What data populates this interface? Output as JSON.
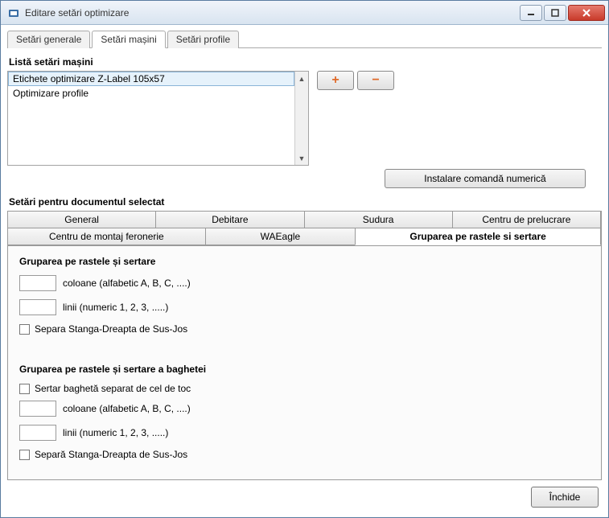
{
  "window": {
    "title": "Editare setări optimizare"
  },
  "topTabs": [
    "Setări generale",
    "Setări mașini",
    "Setări profile"
  ],
  "topTabActive": 1,
  "machineList": {
    "label": "Listă setări mașini",
    "items": [
      "Etichete optimizare Z-Label 105x57",
      "Optimizare profile"
    ],
    "selected": 0,
    "addIcon": "+",
    "removeIcon": "−"
  },
  "installBtn": "Instalare comandă numerică",
  "docSettings": {
    "label": "Setări pentru documentul selectat",
    "tabsRow1": [
      "General",
      "Debitare",
      "Sudura",
      "Centru de prelucrare"
    ],
    "tabsRow2": [
      "Centru de montaj feronerie",
      "WAEagle",
      "Gruparea pe rastele si sertare"
    ],
    "activeRow": 2,
    "activeIndex": 2
  },
  "panel": {
    "group1": {
      "title": "Gruparea pe rastele și sertare",
      "colsValue": "",
      "colsLabel": "coloane (alfabetic A, B, C, ....)",
      "linesValue": "",
      "linesLabel": "linii (numeric 1, 2, 3, .....)",
      "sepLabel": "Separa Stanga-Dreapta de Sus-Jos"
    },
    "group2": {
      "title": "Gruparea pe rastele și sertare a baghetei",
      "sertarLabel": "Sertar baghetă separat de cel de toc",
      "colsValue": "",
      "colsLabel": "coloane (alfabetic A, B, C, ....)",
      "linesValue": "",
      "linesLabel": "linii (numeric 1, 2, 3, .....)",
      "sepLabel": "Separă Stanga-Dreapta de Sus-Jos"
    }
  },
  "footer": {
    "close": "Închide"
  }
}
